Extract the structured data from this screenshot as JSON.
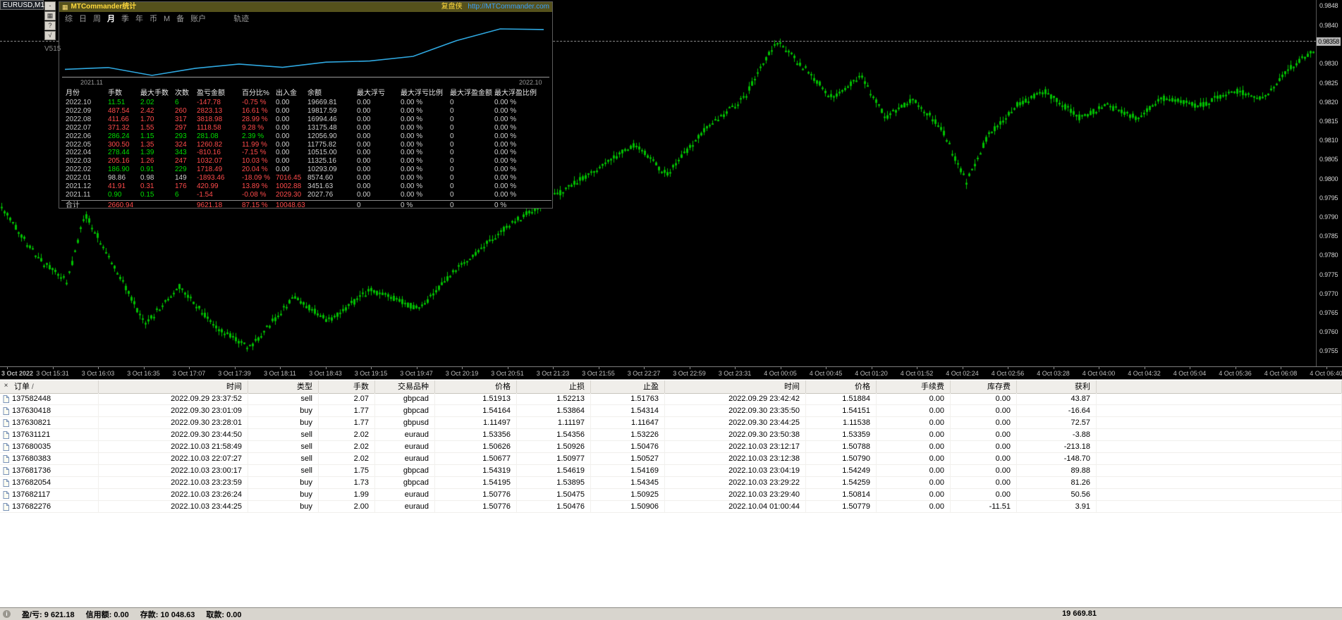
{
  "chart": {
    "symbol_label": "EURUSD,M1"
  },
  "side_toolbar": {
    "buttons": [
      "-",
      "▦",
      "?",
      "√"
    ],
    "version_label": "V515"
  },
  "stats_panel": {
    "title": "MTCommander统计",
    "brand": "复盘侠",
    "url": "http://MTCommander.com",
    "tabs": [
      "综",
      "日",
      "周",
      "月",
      "季",
      "年",
      "币",
      "M",
      "备",
      "账户"
    ],
    "active_tab": "月",
    "extra_tab": "轨迹",
    "equity_chart": {
      "x_start_label": "2021.11",
      "x_end_label": "2022.10",
      "points": [
        -1.54,
        419.45,
        -1474.01,
        244.48,
        1276.55,
        466.39,
        1727.21,
        2008.29,
        3126.87,
        6945.85,
        9768.98,
        9621.2
      ],
      "line_color": "#2fa8e0"
    },
    "table": {
      "headers": [
        "月份",
        "手数",
        "最大手数",
        "次数",
        "盈亏金额",
        "百分比%",
        "出入金",
        "余额",
        "最大浮亏",
        "最大浮亏比例",
        "最大浮盈金额",
        "最大浮盈比例"
      ],
      "rows": [
        {
          "cells": [
            "2022.10",
            "11.51",
            "2.02",
            "6",
            "-147.78",
            "-0.75 %",
            "0.00",
            "19669.81",
            "0.00",
            "0.00 %",
            "0",
            "0.00 %"
          ],
          "colors": [
            "m",
            "g",
            "g",
            "g",
            "r",
            "r",
            "w",
            "b",
            "w",
            "w",
            "w",
            "w"
          ]
        },
        {
          "cells": [
            "2022.09",
            "487.54",
            "2.42",
            "260",
            "2823.13",
            "16.61 %",
            "0.00",
            "19817.59",
            "0.00",
            "0.00 %",
            "0",
            "0.00 %"
          ],
          "colors": [
            "m",
            "r",
            "r",
            "r",
            "r",
            "r",
            "w",
            "b",
            "w",
            "w",
            "w",
            "w"
          ]
        },
        {
          "cells": [
            "2022.08",
            "411.66",
            "1.70",
            "317",
            "3818.98",
            "28.99 %",
            "0.00",
            "16994.46",
            "0.00",
            "0.00 %",
            "0",
            "0.00 %"
          ],
          "colors": [
            "m",
            "r",
            "r",
            "r",
            "r",
            "r",
            "w",
            "b",
            "w",
            "w",
            "w",
            "w"
          ]
        },
        {
          "cells": [
            "2022.07",
            "371.32",
            "1.55",
            "297",
            "1118.58",
            "9.28 %",
            "0.00",
            "13175.48",
            "0.00",
            "0.00 %",
            "0",
            "0.00 %"
          ],
          "colors": [
            "m",
            "r",
            "r",
            "r",
            "r",
            "r",
            "w",
            "b",
            "w",
            "w",
            "w",
            "w"
          ]
        },
        {
          "cells": [
            "2022.06",
            "286.24",
            "1.15",
            "293",
            "281.08",
            "2.39 %",
            "0.00",
            "12056.90",
            "0.00",
            "0.00 %",
            "0",
            "0.00 %"
          ],
          "colors": [
            "m",
            "g",
            "g",
            "g",
            "g",
            "g",
            "w",
            "b",
            "w",
            "w",
            "w",
            "w"
          ]
        },
        {
          "cells": [
            "2022.05",
            "300.50",
            "1.35",
            "324",
            "1260.82",
            "11.99 %",
            "0.00",
            "11775.82",
            "0.00",
            "0.00 %",
            "0",
            "0.00 %"
          ],
          "colors": [
            "m",
            "r",
            "r",
            "r",
            "r",
            "r",
            "w",
            "b",
            "w",
            "w",
            "w",
            "w"
          ]
        },
        {
          "cells": [
            "2022.04",
            "278.44",
            "1.39",
            "343",
            "-810.16",
            "-7.15 %",
            "0.00",
            "10515.00",
            "0.00",
            "0.00 %",
            "0",
            "0.00 %"
          ],
          "colors": [
            "m",
            "g",
            "g",
            "g",
            "r",
            "r",
            "w",
            "b",
            "w",
            "w",
            "w",
            "w"
          ]
        },
        {
          "cells": [
            "2022.03",
            "205.16",
            "1.26",
            "247",
            "1032.07",
            "10.03 %",
            "0.00",
            "11325.16",
            "0.00",
            "0.00 %",
            "0",
            "0.00 %"
          ],
          "colors": [
            "m",
            "r",
            "r",
            "r",
            "r",
            "r",
            "w",
            "b",
            "w",
            "w",
            "w",
            "w"
          ]
        },
        {
          "cells": [
            "2022.02",
            "186.90",
            "0.91",
            "229",
            "1718.49",
            "20.04 %",
            "0.00",
            "10293.09",
            "0.00",
            "0.00 %",
            "0",
            "0.00 %"
          ],
          "colors": [
            "m",
            "g",
            "g",
            "g",
            "r",
            "r",
            "w",
            "b",
            "w",
            "w",
            "w",
            "w"
          ]
        },
        {
          "cells": [
            "2022.01",
            "98.86",
            "0.98",
            "149",
            "-1893.46",
            "-18.09 %",
            "7016.45",
            "8574.60",
            "0.00",
            "0.00 %",
            "0",
            "0.00 %"
          ],
          "colors": [
            "m",
            "w",
            "w",
            "w",
            "r",
            "r",
            "r",
            "b",
            "w",
            "w",
            "w",
            "w"
          ]
        },
        {
          "cells": [
            "2021.12",
            "41.91",
            "0.31",
            "176",
            "420.99",
            "13.89 %",
            "1002.88",
            "3451.63",
            "0.00",
            "0.00 %",
            "0",
            "0.00 %"
          ],
          "colors": [
            "m",
            "r",
            "r",
            "r",
            "r",
            "r",
            "r",
            "b",
            "w",
            "w",
            "w",
            "w"
          ]
        },
        {
          "cells": [
            "2021.11",
            "0.90",
            "0.15",
            "6",
            "-1.54",
            "-0.08 %",
            "2029.30",
            "2027.76",
            "0.00",
            "0.00 %",
            "0",
            "0.00 %"
          ],
          "colors": [
            "m",
            "g",
            "g",
            "g",
            "r",
            "r",
            "r",
            "b",
            "w",
            "w",
            "w",
            "w"
          ]
        }
      ],
      "total": {
        "cells": [
          "合计",
          "2660.94",
          "",
          "",
          "9621.18",
          "87.15 %",
          "10048.63",
          "",
          "0",
          "0 %",
          "0",
          "0 %"
        ],
        "colors": [
          "m",
          "r",
          "w",
          "w",
          "r",
          "r",
          "r",
          "w",
          "w",
          "w",
          "w",
          "w"
        ]
      }
    }
  },
  "price_axis": {
    "labels": [
      "0.9848",
      "0.9840",
      "0.9830",
      "0.9825",
      "0.9820",
      "0.9815",
      "0.9810",
      "0.9805",
      "0.9800",
      "0.9795",
      "0.9790",
      "0.9785",
      "0.9780",
      "0.9775",
      "0.9770",
      "0.9765",
      "0.9760",
      "0.9755"
    ],
    "current": "0.98358"
  },
  "time_axis": {
    "labels": [
      "3 Oct 2022",
      "3 Oct 15:31",
      "3 Oct 16:03",
      "3 Oct 16:35",
      "3 Oct 17:07",
      "3 Oct 17:39",
      "3 Oct 18:11",
      "3 Oct 18:43",
      "3 Oct 19:15",
      "3 Oct 19:47",
      "3 Oct 20:19",
      "3 Oct 20:51",
      "3 Oct 21:23",
      "3 Oct 21:55",
      "3 Oct 22:27",
      "3 Oct 22:59",
      "3 Oct 23:31",
      "4 Oct 00:05",
      "4 Oct 00:45",
      "4 Oct 01:20",
      "4 Oct 01:52",
      "4 Oct 02:24",
      "4 Oct 02:56",
      "4 Oct 03:28",
      "4 Oct 04:00",
      "4 Oct 04:32",
      "4 Oct 05:04",
      "4 Oct 05:36",
      "4 Oct 06:08",
      "4 Oct 06:40"
    ]
  },
  "candles": {
    "color": "#00c000",
    "seed": 42,
    "waypoints": [
      [
        0,
        0.9793
      ],
      [
        55,
        0.9779
      ],
      [
        95,
        0.9773
      ],
      [
        120,
        0.9791
      ],
      [
        165,
        0.9776
      ],
      [
        205,
        0.9762
      ],
      [
        255,
        0.9772
      ],
      [
        305,
        0.9761
      ],
      [
        355,
        0.9756
      ],
      [
        415,
        0.9769
      ],
      [
        465,
        0.9763
      ],
      [
        525,
        0.9771
      ],
      [
        595,
        0.9766
      ],
      [
        645,
        0.9776
      ],
      [
        715,
        0.9787
      ],
      [
        790,
        0.9796
      ],
      [
        850,
        0.9803
      ],
      [
        900,
        0.9809
      ],
      [
        945,
        0.9801
      ],
      [
        1000,
        0.9813
      ],
      [
        1055,
        0.9821
      ],
      [
        1100,
        0.9836
      ],
      [
        1140,
        0.9829
      ],
      [
        1180,
        0.9821
      ],
      [
        1220,
        0.9827
      ],
      [
        1255,
        0.9816
      ],
      [
        1295,
        0.9821
      ],
      [
        1335,
        0.9813
      ],
      [
        1370,
        0.9799
      ],
      [
        1400,
        0.9811
      ],
      [
        1440,
        0.9819
      ],
      [
        1480,
        0.9823
      ],
      [
        1530,
        0.9816
      ],
      [
        1570,
        0.9819
      ],
      [
        1610,
        0.9816
      ],
      [
        1650,
        0.9821
      ],
      [
        1700,
        0.9819
      ],
      [
        1750,
        0.9823
      ],
      [
        1790,
        0.9821
      ],
      [
        1830,
        0.9829
      ],
      [
        1858,
        0.9833
      ],
      [
        1878,
        0.98358
      ]
    ]
  },
  "orders_panel": {
    "close_label": "×",
    "sort_indicator": "/",
    "headers": [
      "订单",
      "时间",
      "类型",
      "手数",
      "交易品种",
      "价格",
      "止损",
      "止盈",
      "时间",
      "价格",
      "手续费",
      "库存费",
      "获利"
    ],
    "rows": [
      [
        "137582448",
        "2022.09.29 23:37:52",
        "sell",
        "2.07",
        "gbpcad",
        "1.51913",
        "1.52213",
        "1.51763",
        "2022.09.29 23:42:42",
        "1.51884",
        "0.00",
        "0.00",
        "43.87"
      ],
      [
        "137630418",
        "2022.09.30 23:01:09",
        "buy",
        "1.77",
        "gbpcad",
        "1.54164",
        "1.53864",
        "1.54314",
        "2022.09.30 23:35:50",
        "1.54151",
        "0.00",
        "0.00",
        "-16.64"
      ],
      [
        "137630821",
        "2022.09.30 23:28:01",
        "buy",
        "1.77",
        "gbpusd",
        "1.11497",
        "1.11197",
        "1.11647",
        "2022.09.30 23:44:25",
        "1.11538",
        "0.00",
        "0.00",
        "72.57"
      ],
      [
        "137631121",
        "2022.09.30 23:44:50",
        "sell",
        "2.02",
        "euraud",
        "1.53356",
        "1.54356",
        "1.53226",
        "2022.09.30 23:50:38",
        "1.53359",
        "0.00",
        "0.00",
        "-3.88"
      ],
      [
        "137680035",
        "2022.10.03 21:58:49",
        "sell",
        "2.02",
        "euraud",
        "1.50626",
        "1.50926",
        "1.50476",
        "2022.10.03 23:12:17",
        "1.50788",
        "0.00",
        "0.00",
        "-213.18"
      ],
      [
        "137680383",
        "2022.10.03 22:07:27",
        "sell",
        "2.02",
        "euraud",
        "1.50677",
        "1.50977",
        "1.50527",
        "2022.10.03 23:12:38",
        "1.50790",
        "0.00",
        "0.00",
        "-148.70"
      ],
      [
        "137681736",
        "2022.10.03 23:00:17",
        "sell",
        "1.75",
        "gbpcad",
        "1.54319",
        "1.54619",
        "1.54169",
        "2022.10.03 23:04:19",
        "1.54249",
        "0.00",
        "0.00",
        "89.88"
      ],
      [
        "137682054",
        "2022.10.03 23:23:59",
        "buy",
        "1.73",
        "gbpcad",
        "1.54195",
        "1.53895",
        "1.54345",
        "2022.10.03 23:29:22",
        "1.54259",
        "0.00",
        "0.00",
        "81.26"
      ],
      [
        "137682117",
        "2022.10.03 23:26:24",
        "buy",
        "1.99",
        "euraud",
        "1.50776",
        "1.50475",
        "1.50925",
        "2022.10.03 23:29:40",
        "1.50814",
        "0.00",
        "0.00",
        "50.56"
      ],
      [
        "137682276",
        "2022.10.03 23:44:25",
        "buy",
        "2.00",
        "euraud",
        "1.50776",
        "1.50476",
        "1.50906",
        "2022.10.04 01:00:44",
        "1.50779",
        "0.00",
        "-11.51",
        "3.91"
      ]
    ]
  },
  "status_bar": {
    "items": [
      "盈/亏: 9 621.18",
      "信用额: 0.00",
      "存款: 10 048.63",
      "取款: 0.00"
    ],
    "total": "19 669.81"
  }
}
